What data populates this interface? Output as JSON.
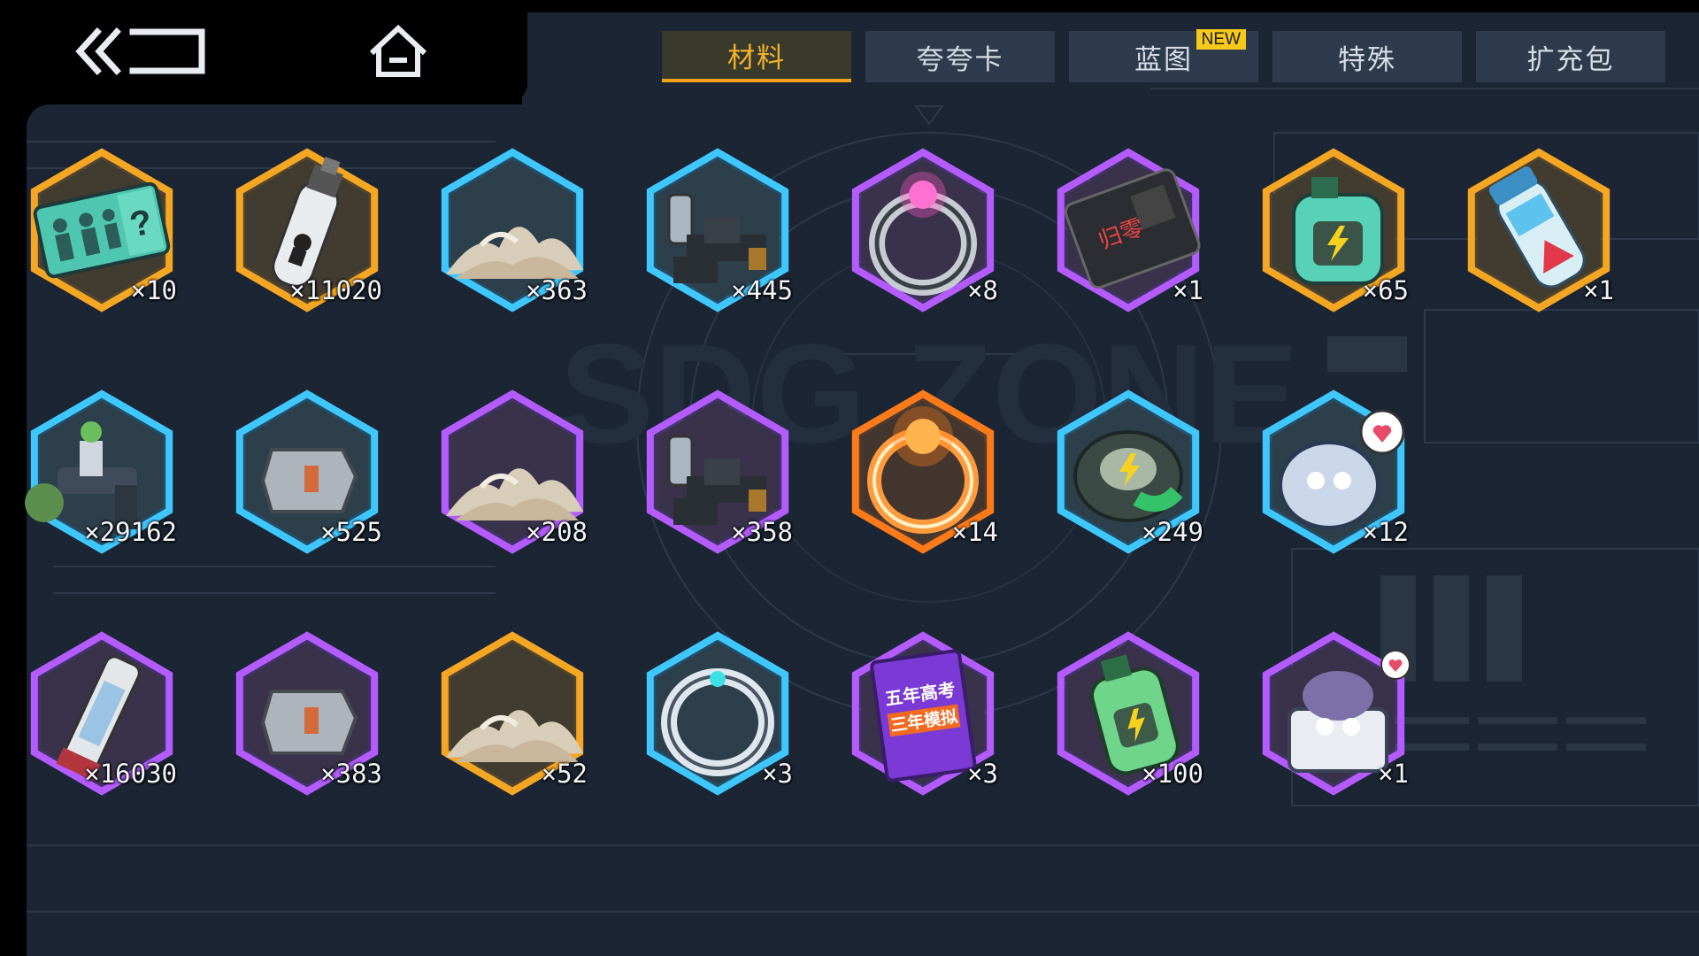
{
  "nav": {
    "back_icon": "double-chevron-back-icon",
    "home_icon": "home-icon"
  },
  "tabs": [
    {
      "label": "材料",
      "active": true,
      "badge": ""
    },
    {
      "label": "夸夸卡",
      "active": false,
      "badge": ""
    },
    {
      "label": "蓝图",
      "active": false,
      "badge": "NEW"
    },
    {
      "label": "特殊",
      "active": false,
      "badge": ""
    },
    {
      "label": "扩充包",
      "active": false,
      "badge": ""
    }
  ],
  "background_logo_text": "SDG ZONE",
  "colors": {
    "tab_active_text": "#f3b12a",
    "tab_active_underline": "#f0a21c",
    "badge_bg": "#f6c91a",
    "rarity_gold": "#f5a623",
    "rarity_purple": "#b45cff",
    "rarity_blue": "#3fc8ff",
    "rarity_orange": "#ff7a18"
  },
  "items": [
    {
      "name": "super-ticket-item",
      "rarity": "gold",
      "icon": "ticket",
      "count": "×10"
    },
    {
      "name": "potion-tube-item",
      "rarity": "gold",
      "icon": "tube",
      "count": "×11020"
    },
    {
      "name": "sand-pile-item",
      "rarity": "blue",
      "icon": "sand",
      "count": "×363"
    },
    {
      "name": "machine-parts-item",
      "rarity": "blue",
      "icon": "parts",
      "count": "×445"
    },
    {
      "name": "gem-ring-item",
      "rarity": "purple",
      "icon": "ring-gem",
      "count": "×8"
    },
    {
      "name": "id-card-item",
      "rarity": "purple",
      "icon": "card",
      "count": "×1"
    },
    {
      "name": "energy-bottle-item",
      "rarity": "gold",
      "icon": "bottle",
      "count": "×65"
    },
    {
      "name": "blue-vial-item",
      "rarity": "gold",
      "icon": "vial",
      "count": "×1"
    },
    {
      "name": "robot-arm-item",
      "rarity": "blue",
      "icon": "arm",
      "count": "×29162"
    },
    {
      "name": "chip-plate-item",
      "rarity": "blue",
      "icon": "plate",
      "count": "×525"
    },
    {
      "name": "sand-pile-item-purple",
      "rarity": "purple",
      "icon": "sand",
      "count": "×208"
    },
    {
      "name": "machine-parts-item-purple",
      "rarity": "purple",
      "icon": "parts",
      "count": "×358"
    },
    {
      "name": "fire-ring-item",
      "rarity": "orange",
      "icon": "ring-fire",
      "count": "×14"
    },
    {
      "name": "energy-chip-item",
      "rarity": "blue",
      "icon": "chip",
      "count": "×249"
    },
    {
      "name": "mascot-pouch-item",
      "rarity": "blue",
      "icon": "mascot",
      "count": "×12"
    },
    {
      "name": "battery-item",
      "rarity": "purple",
      "icon": "battery",
      "count": "×16030"
    },
    {
      "name": "chip-plate-item-purple",
      "rarity": "purple",
      "icon": "plate",
      "count": "×383"
    },
    {
      "name": "sand-pile-item-gold",
      "rarity": "gold",
      "icon": "sand",
      "count": "×52"
    },
    {
      "name": "silver-ring-item",
      "rarity": "blue",
      "icon": "ring-silver",
      "count": "×3"
    },
    {
      "name": "exam-book-item",
      "rarity": "purple",
      "icon": "book",
      "count": "×3",
      "text": "五年高考\n三年模拟"
    },
    {
      "name": "green-bottle-item",
      "rarity": "purple",
      "icon": "bottle-green",
      "count": "×100"
    },
    {
      "name": "mascot-box-item",
      "rarity": "purple",
      "icon": "mascot-box",
      "count": "×1"
    }
  ]
}
